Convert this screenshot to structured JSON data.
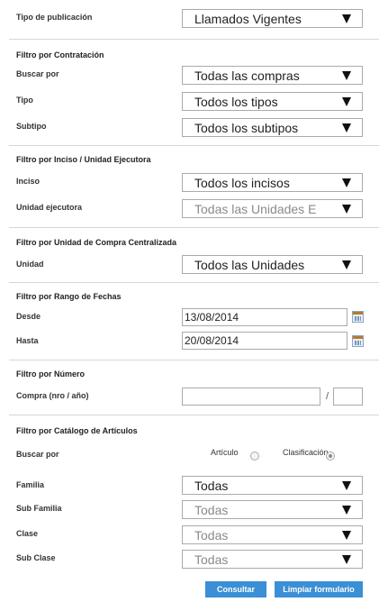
{
  "tipo_publicacion": {
    "label": "Tipo de publicación",
    "value": "Llamados Vigentes"
  },
  "contratacion": {
    "title": "Filtro por Contratación",
    "buscar_label": "Buscar por",
    "buscar_value": "Todas las compras",
    "tipo_label": "Tipo",
    "tipo_value": "Todos los tipos",
    "subtipo_label": "Subtipo",
    "subtipo_value": "Todos los subtipos"
  },
  "inciso": {
    "title": "Filtro por Inciso / Unidad Ejecutora",
    "inciso_label": "Inciso",
    "inciso_value": "Todos los incisos",
    "unidad_label": "Unidad ejecutora",
    "unidad_value": "Todas las Unidades E"
  },
  "compra_centralizada": {
    "title": "Filtro por Unidad de Compra Centralizada",
    "unidad_label": "Unidad",
    "unidad_value": "Todos las Unidades"
  },
  "fechas": {
    "title": "Filtro por Rango de Fechas",
    "desde_label": "Desde",
    "desde_value": "13/08/2014",
    "hasta_label": "Hasta",
    "hasta_value": "20/08/2014"
  },
  "numero": {
    "title": "Filtro por Número",
    "compra_label": "Compra (nro / año)",
    "separator": "/"
  },
  "catalogo": {
    "title": "Filtro por Catálogo de Artículos",
    "buscar_label": "Buscar por",
    "radio_articulo": "Artículo",
    "radio_clasificacion": "Clasificación",
    "selected_radio": "Clasificación",
    "familia_label": "Familia",
    "familia_value": "Todas",
    "subfamilia_label": "Sub Familia",
    "subfamilia_value": "Todas",
    "clase_label": "Clase",
    "clase_value": "Todas",
    "subclase_label": "Sub Clase",
    "subclase_value": "Todas"
  },
  "buttons": {
    "consultar": "Consultar",
    "limpiar": "Limpiar formulario"
  },
  "colors": {
    "button_bg": "#3a8fd6",
    "separator": "#d6d6d6"
  },
  "icons": {
    "calendar": "calendar-icon",
    "dropdown": "chevron-down-icon"
  }
}
